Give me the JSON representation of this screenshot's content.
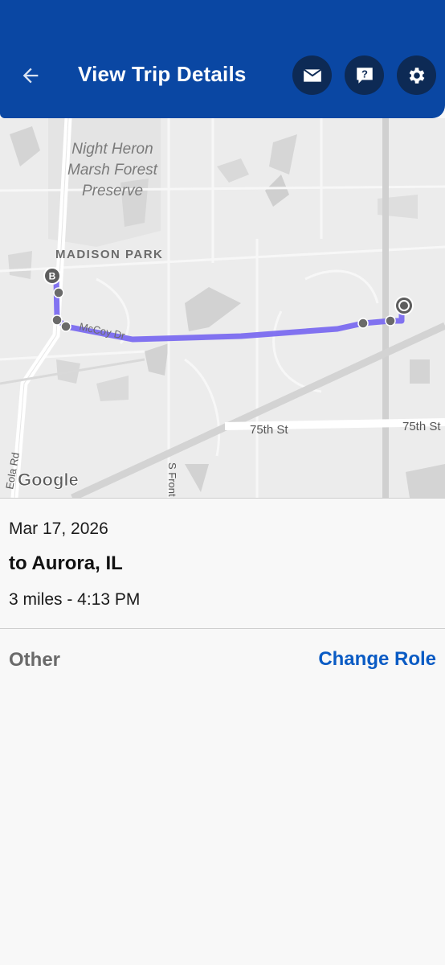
{
  "header": {
    "title": "View Trip Details",
    "background_color": "#0a47a3",
    "button_color": "#0d2a55",
    "icons": [
      "back-arrow-icon",
      "mail-icon",
      "help-icon",
      "settings-icon"
    ]
  },
  "map": {
    "labels": {
      "preserve": [
        "Night Heron",
        "Marsh Forest",
        "Preserve"
      ],
      "neighborhood": "MADISON PARK",
      "street_mccoy": "McCoy Dr",
      "street_75th_a": "75th St",
      "street_75th_b": "75th St",
      "street_eola": "Eola Rd",
      "street_front": "S Front",
      "attribution": "Google"
    },
    "markers": {
      "start": "B"
    },
    "route_color": "#7b6cf0"
  },
  "trip": {
    "date": "Mar 17, 2026",
    "destination": "to Aurora, IL",
    "details": "3 miles - 4:13 PM",
    "role": "Other",
    "change_role_label": "Change Role",
    "accent_color": "#0a5bc4"
  }
}
